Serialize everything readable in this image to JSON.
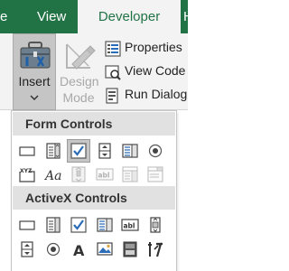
{
  "tabs": [
    {
      "label": "e"
    },
    {
      "label": "View"
    },
    {
      "label": "Developer",
      "active": true
    },
    {
      "label": "Hel"
    }
  ],
  "ribbon": {
    "insert_label": "Insert",
    "design_mode_label": "Design Mode",
    "properties_label": "Properties",
    "view_code_label": "View Code",
    "run_dialog_label": "Run Dialog"
  },
  "dropdown": {
    "form_controls_header": "Form Controls",
    "activex_controls_header": "ActiveX Controls",
    "form_controls": [
      [
        "button-icon",
        "combo-box-icon",
        "check-box-icon",
        "spin-button-icon",
        "list-box-icon",
        "option-button-icon"
      ],
      [
        "group-box-icon",
        "label-icon",
        "scroll-bar-icon",
        "text-field-icon",
        "combo-list-edit-icon",
        "combo-drop-down-edit-icon"
      ]
    ],
    "activex_controls": [
      [
        "command-button-icon",
        "combo-box-icon",
        "check-box-icon",
        "text-box-icon",
        "list-box-icon",
        "scroll-bar-icon"
      ],
      [
        "spin-button-icon",
        "option-button-icon",
        "label-icon",
        "image-icon",
        "toggle-button-icon",
        "more-controls-icon"
      ]
    ],
    "selected_control": "check-box-icon"
  },
  "colors": {
    "excel_green": "#217346",
    "ribbon_bg": "#f3f3f3",
    "section_header_bg": "#e1e1e1",
    "checkmark_blue": "#2b6cb8"
  }
}
